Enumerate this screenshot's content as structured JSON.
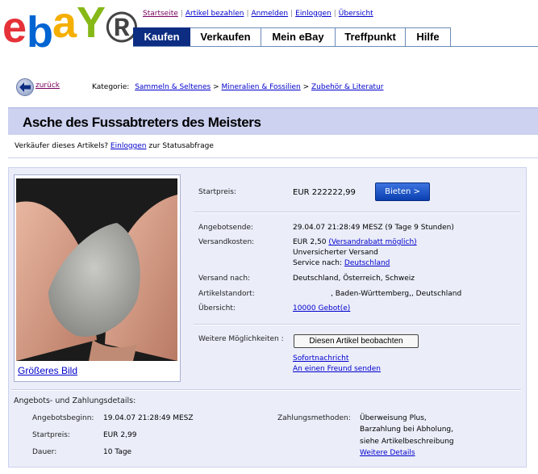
{
  "logo": {
    "letters": [
      "e",
      "b",
      "a",
      "Y"
    ],
    "colors": [
      "#e53238",
      "#0064d2",
      "#f5af02",
      "#86b817"
    ],
    "registered": "®"
  },
  "toplinks": [
    "Startseite",
    "Artikel bezahlen",
    "Anmelden",
    "Einloggen",
    "Übersicht"
  ],
  "nav": [
    "Kaufen",
    "Verkaufen",
    "Mein eBay",
    "Treffpunkt",
    "Hilfe"
  ],
  "breadcrumb": {
    "back": "zurück",
    "label": "Kategorie:",
    "items": [
      "Sammeln & Seltenes",
      "Mineralien & Fossilien",
      "Zubehör & Literatur"
    ],
    "sep": ">"
  },
  "title": "Asche des Fussabtreters des Meisters",
  "seller": {
    "before": "Verkäufer dieses Artikels?",
    "link": "Einloggen",
    "after": "zur Statusabfrage"
  },
  "image": {
    "link": "Größeres Bild"
  },
  "details": {
    "start_label": "Startpreis:",
    "start_value": "EUR  222222,99",
    "bid_button": "Bieten >",
    "end_label": "Angebotsende:",
    "end_value": "29.04.07 21:28:49 MESZ (9 Tage 9 Stunden)",
    "ship_label": "Versandkosten:",
    "ship_value": "EUR 2,50",
    "ship_link": "(Versandrabatt möglich)",
    "ship_line2": "Unversicherter Versand",
    "ship_line3_prefix": "Service nach:",
    "ship_line3_link": "Deutschland",
    "to_label": "Versand nach:",
    "to_value": "Deutschland, Österreich, Schweiz",
    "loc_label": "Artikelstandort:",
    "loc_value": ", Baden-Württemberg,, Deutschland",
    "overview_label": "Übersicht:",
    "overview_link": "10000 Gebot(e)",
    "more_label": "Weitere Möglichkeiten :",
    "watch_button": "Diesen Artikel beobachten",
    "instant_link": "Sofortnachricht",
    "friend_link": "An einen Freund senden"
  },
  "terms": {
    "heading": "Angebots- und Zahlungsdetails:",
    "begin_label": "Angebotsbeginn:",
    "begin_value": "19.04.07 21:28:49 MESZ",
    "price_label": "Startpreis:",
    "price_value": "EUR 2,99",
    "dur_label": "Dauer:",
    "dur_value": "10 Tage",
    "pay_label": "Zahlungsmethoden:",
    "pay_lines": [
      "Überweisung Plus,",
      "Barzahlung bei Abholung,",
      "siehe Artikelbeschreibung"
    ],
    "pay_link": "Weitere Details"
  }
}
